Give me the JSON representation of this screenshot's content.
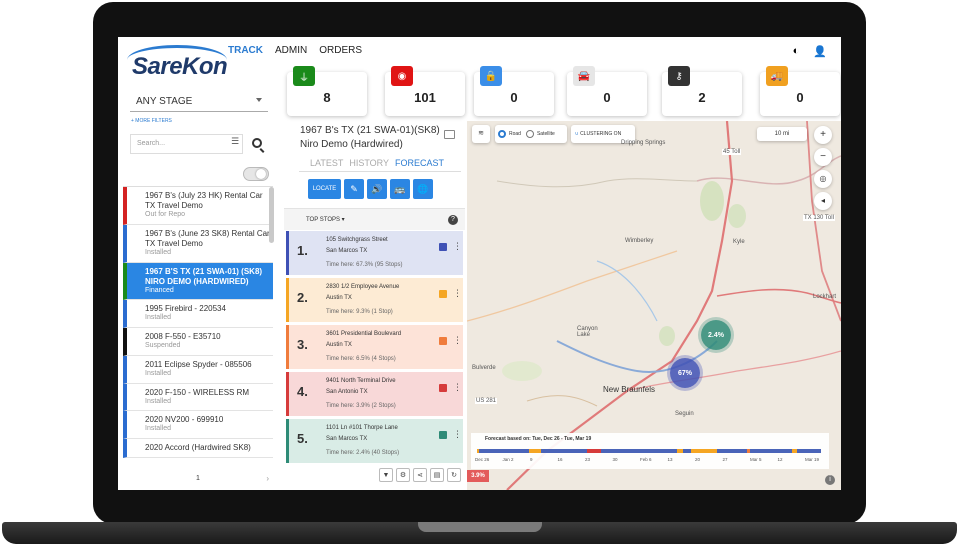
{
  "header": {
    "logo_text": "SareKon",
    "nav": [
      {
        "label": "TRACK",
        "active": true
      },
      {
        "label": "ADMIN",
        "active": false
      },
      {
        "label": "ORDERS",
        "active": false
      }
    ],
    "icons": [
      "contrast-icon",
      "user-icon"
    ]
  },
  "stats": [
    {
      "icon": "plug-icon",
      "glyph": "⏚",
      "color": "#1a8a1a",
      "value": "8"
    },
    {
      "icon": "alarm-icon",
      "glyph": "◉",
      "color": "#e01414",
      "value": "101"
    },
    {
      "icon": "lock-icon",
      "glyph": "🔒",
      "color": "#3b8ee8",
      "value": "0"
    },
    {
      "icon": "car-icon",
      "glyph": "🚘",
      "color": "#e6e6e6",
      "value": "0"
    },
    {
      "icon": "key-icon",
      "glyph": "⚷",
      "color": "#333333",
      "value": "2"
    },
    {
      "icon": "tow-truck-icon",
      "glyph": "🚚",
      "color": "#f0a020",
      "value": "0"
    }
  ],
  "filters": {
    "stage_value": "ANY STAGE",
    "more_filters": "+ MORE FILTERS",
    "search_placeholder": "Search..."
  },
  "vehicles": [
    {
      "name": "1967 B's (July 23 HK) Rental Car TX Travel Demo",
      "status": "Out for Repo",
      "color": "#d42222",
      "selected": false
    },
    {
      "name": "1967 B's (June 23 SK8) Rental Car TX Travel Demo",
      "status": "Installed",
      "color": "#2b6cd0",
      "selected": false
    },
    {
      "name": "1967 B'S TX (21 SWA-01) (SK8) NIRO DEMO (HARDWIRED)",
      "status": "Financed",
      "color": "#1a8a1a",
      "selected": true
    },
    {
      "name": "1995 Firebird - 220534",
      "status": "Installed",
      "color": "#2b6cd0",
      "selected": false
    },
    {
      "name": "2008 F-550 - E35710",
      "status": "Suspended",
      "color": "#111111",
      "selected": false
    },
    {
      "name": "2011 Eclipse Spyder - 085506",
      "status": "Installed",
      "color": "#2b6cd0",
      "selected": false
    },
    {
      "name": "2020 F-150 - WIRELESS RM",
      "status": "Installed",
      "color": "#2b6cd0",
      "selected": false
    },
    {
      "name": "2020 NV200 - 699910",
      "status": "Installed",
      "color": "#2b6cd0",
      "selected": false
    },
    {
      "name": "2020 Accord (Hardwired SK8)",
      "status": "",
      "color": "#2b6cd0",
      "selected": false
    }
  ],
  "pager": {
    "page": "1",
    "next": "›"
  },
  "detail": {
    "title": "1967 B's TX (21 SWA-01)(SK8) Niro Demo (Hardwired)",
    "tabs": [
      {
        "label": "LATEST",
        "active": false
      },
      {
        "label": "HISTORY",
        "active": false
      },
      {
        "label": "FORECAST",
        "active": true
      }
    ],
    "actions": [
      {
        "label": "LOCATE",
        "icon": ""
      },
      {
        "label": "",
        "icon": "✎"
      },
      {
        "label": "",
        "icon": "🔊"
      },
      {
        "label": "",
        "icon": "🚌"
      },
      {
        "label": "",
        "icon": "🌐"
      }
    ],
    "top_stops_label": "TOP STOPS ▾",
    "help": "?"
  },
  "stops": [
    {
      "num": "1.",
      "street": "105 Switchgrass Street",
      "city": "San Marcos TX",
      "time": "Time here: 67.3% (95 Stops)",
      "bg": "#dfe3f3",
      "border": "#3f51b5",
      "check": "#3f51b5"
    },
    {
      "num": "2.",
      "street": "2830 1/2 Employee Avenue",
      "city": "Austin TX",
      "time": "Time here: 9.3% (1 Stop)",
      "bg": "#fdebd4",
      "border": "#f5a623",
      "check": "#f5a623"
    },
    {
      "num": "3.",
      "street": "3601 Presidential Boulevard",
      "city": "Austin TX",
      "time": "Time here: 6.5% (4 Stops)",
      "bg": "#fde3d8",
      "border": "#f07c3c",
      "check": "#f07c3c"
    },
    {
      "num": "4.",
      "street": "9401 North Terminal Drive",
      "city": "San Antonio TX",
      "time": "Time here: 3.9% (2 Stops)",
      "bg": "#f8d8d8",
      "border": "#d63b3b",
      "check": "#d63b3b"
    },
    {
      "num": "5.",
      "street": "1101 Ln #101 Thorpe Lane",
      "city": "San Marcos TX",
      "time": "Time here: 2.4% (40 Stops)",
      "bg": "#d9ece6",
      "border": "#2e8b77",
      "check": "#2e8b77"
    }
  ],
  "map": {
    "road_label": "Road",
    "satellite_label": "Satellite",
    "clustering_label": "CLUSTERING ON",
    "scale_label": "10 mi",
    "places": [
      {
        "name": "Dripping Springs"
      },
      {
        "name": "45 Toll"
      },
      {
        "name": "TX 130 Toll"
      },
      {
        "name": "Wimberley"
      },
      {
        "name": "Kyle"
      },
      {
        "name": "Lockhart"
      },
      {
        "name": "Canyon Lake"
      },
      {
        "name": "New Braunfels"
      },
      {
        "name": "Bulverde"
      },
      {
        "name": "Seguin"
      },
      {
        "name": "US 281"
      }
    ],
    "clusters": [
      {
        "label": "2.4%"
      },
      {
        "label": "67%"
      }
    ],
    "forecast_label": "Forecast based on: Tue, Dec 26 - Tue, Mar 19",
    "ticks": [
      "Dec 26",
      "Jan 2",
      "9",
      "16",
      "23",
      "30",
      "Feb 6",
      "13",
      "20",
      "27",
      "Mar 5",
      "12",
      "Mar 19"
    ],
    "badge": "3.9%",
    "info": "i"
  }
}
